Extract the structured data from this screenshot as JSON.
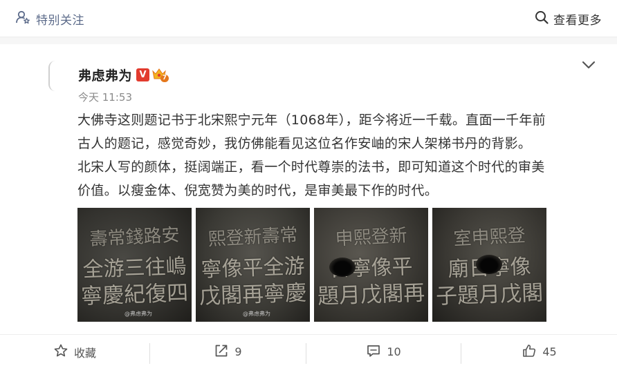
{
  "top_bar": {
    "special_follow_label": "特别关注",
    "see_more_label": "查看更多"
  },
  "post": {
    "author": "弗虑弗为",
    "verified_badge": "V",
    "level_badge": "7",
    "time": "今天 11:53",
    "paragraphs": [
      "大佛寺这则题记书于北宋熙宁元年（1068年），距今将近一千载。直面一千年前",
      "古人的题记，感觉奇妙，我仿佛能看见这位名作安岫的宋人架梯书丹的背影。",
      "北宋人写的颜体，挺阔端正，看一个时代尊崇的法书，即可知道这个时代的审美",
      "价值。以瘦金体、倪宽赞为美的时代，是审美最下作的时代。"
    ],
    "images": [
      {
        "rows": [
          "壽常錢路安",
          "全游三往嶋",
          "寧慶紀復四"
        ],
        "watermark": "@弗虑弗为"
      },
      {
        "rows": [
          "熙登新壽常",
          "寧像平全游",
          "戊閣再寧慶"
        ],
        "watermark": "@弗虑弗为"
      },
      {
        "rows": [
          "申熙登新",
          "日寧像平",
          "題月戊閣再"
        ],
        "watermark": ""
      },
      {
        "rows": [
          "室申熙登",
          "廟日寧像",
          "子題月戊閣"
        ],
        "watermark": ""
      }
    ]
  },
  "actions": {
    "favorite_label": "收藏",
    "repost_count": "9",
    "comment_count": "10",
    "like_count": "45"
  },
  "colors": {
    "link_blue": "#5c6b8a",
    "verified_red": "#e23b2e",
    "level_orange": "#e5781d"
  }
}
